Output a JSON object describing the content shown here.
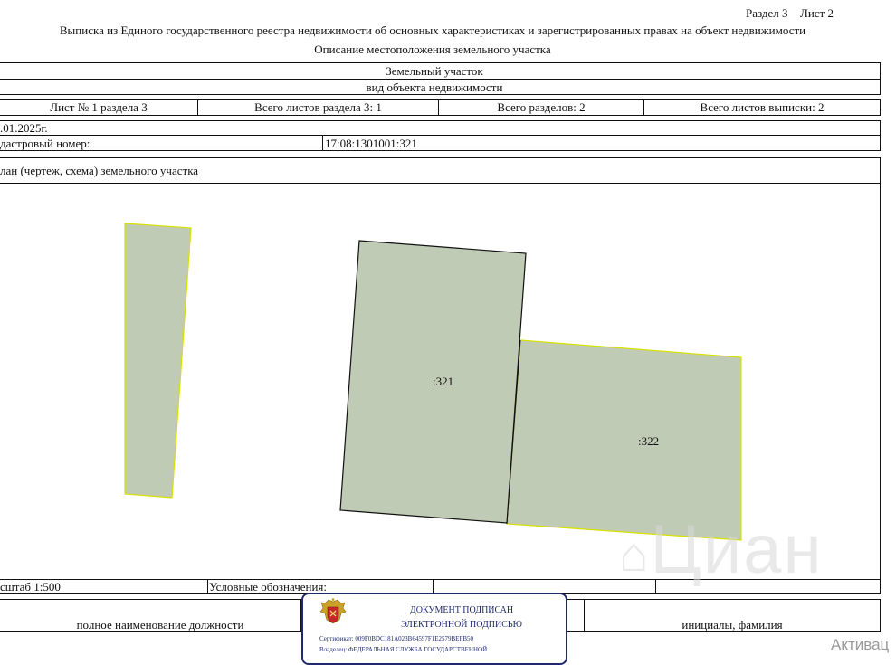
{
  "header": {
    "section_label": "Раздел 3",
    "sheet_label": "Лист 2",
    "title": "Выписка из Единого государственного реестра недвижимости об основных характеристиках и зарегистрированных правах на объект недвижимости",
    "subtitle": "Описание местоположения земельного участка"
  },
  "object": {
    "name": "Земельный участок",
    "kind_caption": "вид объекта недвижимости"
  },
  "sheet_info": {
    "sheet_of_section": "Лист № 1 раздела 3",
    "total_sheets_section": "Всего листов раздела 3: 1",
    "total_sections": "Всего разделов: 2",
    "total_sheets_extract": "Всего листов выписки: 2"
  },
  "date_partial": ".01.2025г.",
  "cadastral": {
    "label_partial": "дастровый номер:",
    "number": "17:08:1301001:321"
  },
  "plan": {
    "title_partial": "лан (чертеж, схема) земельного участка",
    "parcel_main_label": ":321",
    "parcel_neighbor_label": ":322",
    "fill_color": "#bfcbb5",
    "edge_color": "#d8e000"
  },
  "footer": {
    "scale_partial": "сштаб 1:500",
    "legend_label": "Условные обозначения:",
    "position_caption": "полное наименование должности",
    "initials_caption": "инициалы, фамилия"
  },
  "stamp": {
    "line1": "ДОКУМЕНТ ПОДПИСАН",
    "line2": "ЭЛЕКТРОННОЙ ПОДПИСЬЮ",
    "certificate": "Сертификат: 009F0BDC181A023B64597F1E2579BEFB50",
    "owner": "Владелец: ФЕДЕРАЛЬНАЯ СЛУЖБА ГОСУДАРСТВЕННОЙ",
    "color": "#1f2a6e"
  },
  "watermarks": {
    "brand": "Циан",
    "os_partial": "Активац"
  }
}
